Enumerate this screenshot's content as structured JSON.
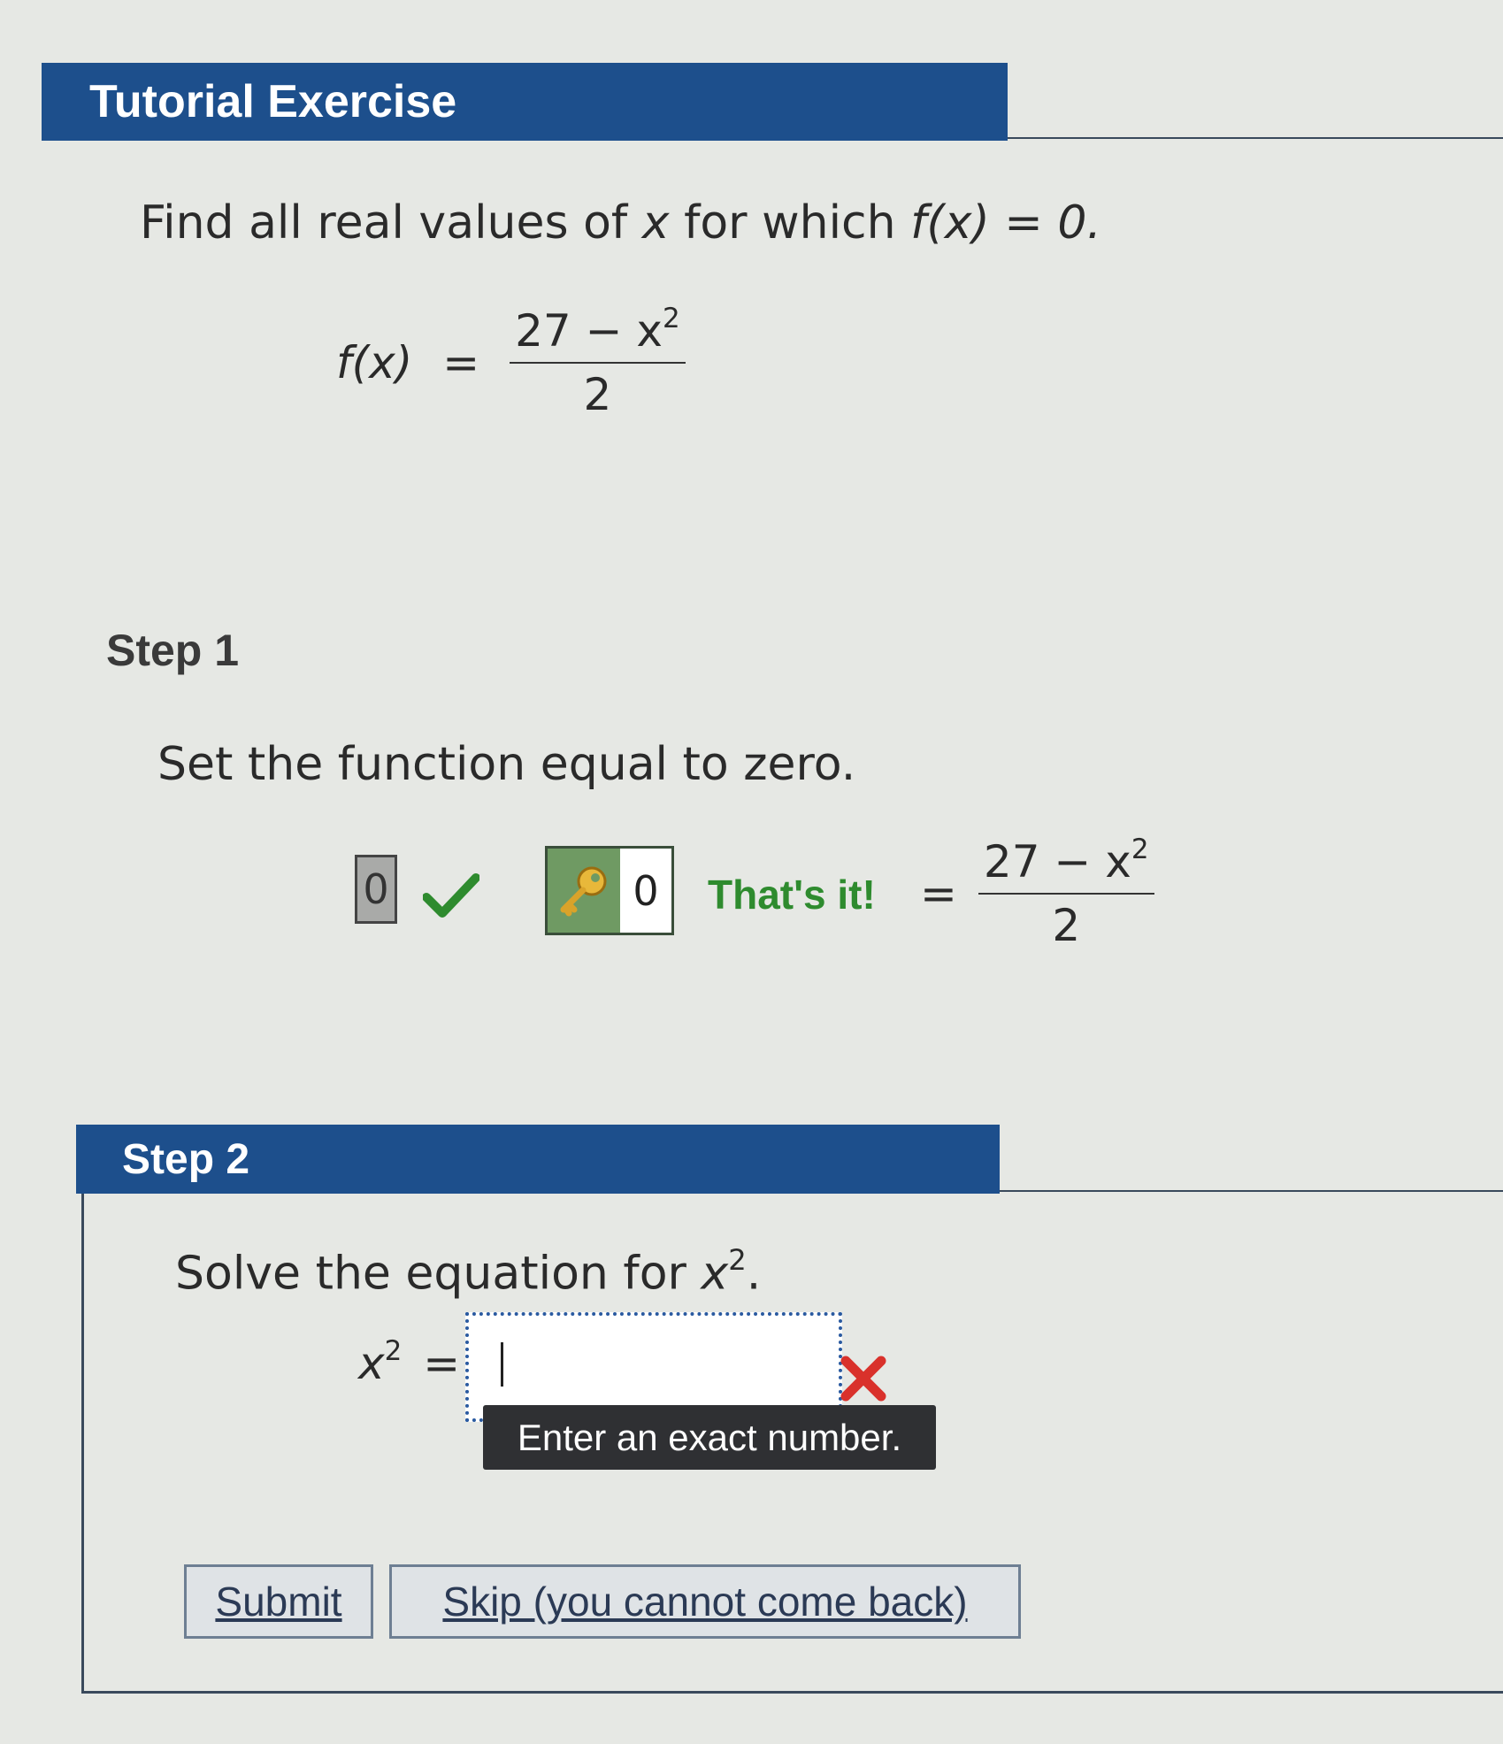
{
  "tutorial": {
    "title": "Tutorial Exercise",
    "prompt_text": "Find all real values of",
    "prompt_var": "x",
    "prompt_mid": "for which",
    "prompt_func": "f(x) = 0.",
    "function_lhs": "f(x)",
    "equals": "=",
    "numerator": "27 − x",
    "exponent": "2",
    "denominator": "2"
  },
  "step1": {
    "title": "Step 1",
    "instruction": "Set the function equal to zero.",
    "answer_value": "0",
    "key_value": "0",
    "feedback": "That's it!",
    "equals": "=",
    "numerator": "27 − x",
    "exponent": "2",
    "denominator": "2"
  },
  "step2": {
    "title": "Step 2",
    "instruction": "Solve the equation for",
    "instruction_var": "x",
    "instruction_exp": "2",
    "instruction_end": ".",
    "lhs_var": "x",
    "lhs_exp": "2",
    "equals": "=",
    "input_value": "",
    "tooltip": "Enter an exact number.",
    "submit_label": "Submit",
    "skip_label": "Skip (you cannot come back)"
  },
  "colors": {
    "header": "#1d4f8c",
    "correct_green": "#2e8b2e",
    "error_red": "#d9312b",
    "tooltip_bg": "#2f3033"
  },
  "icons": {
    "correct": "checkmark-icon",
    "key": "key-icon",
    "error": "x-mark-icon"
  }
}
